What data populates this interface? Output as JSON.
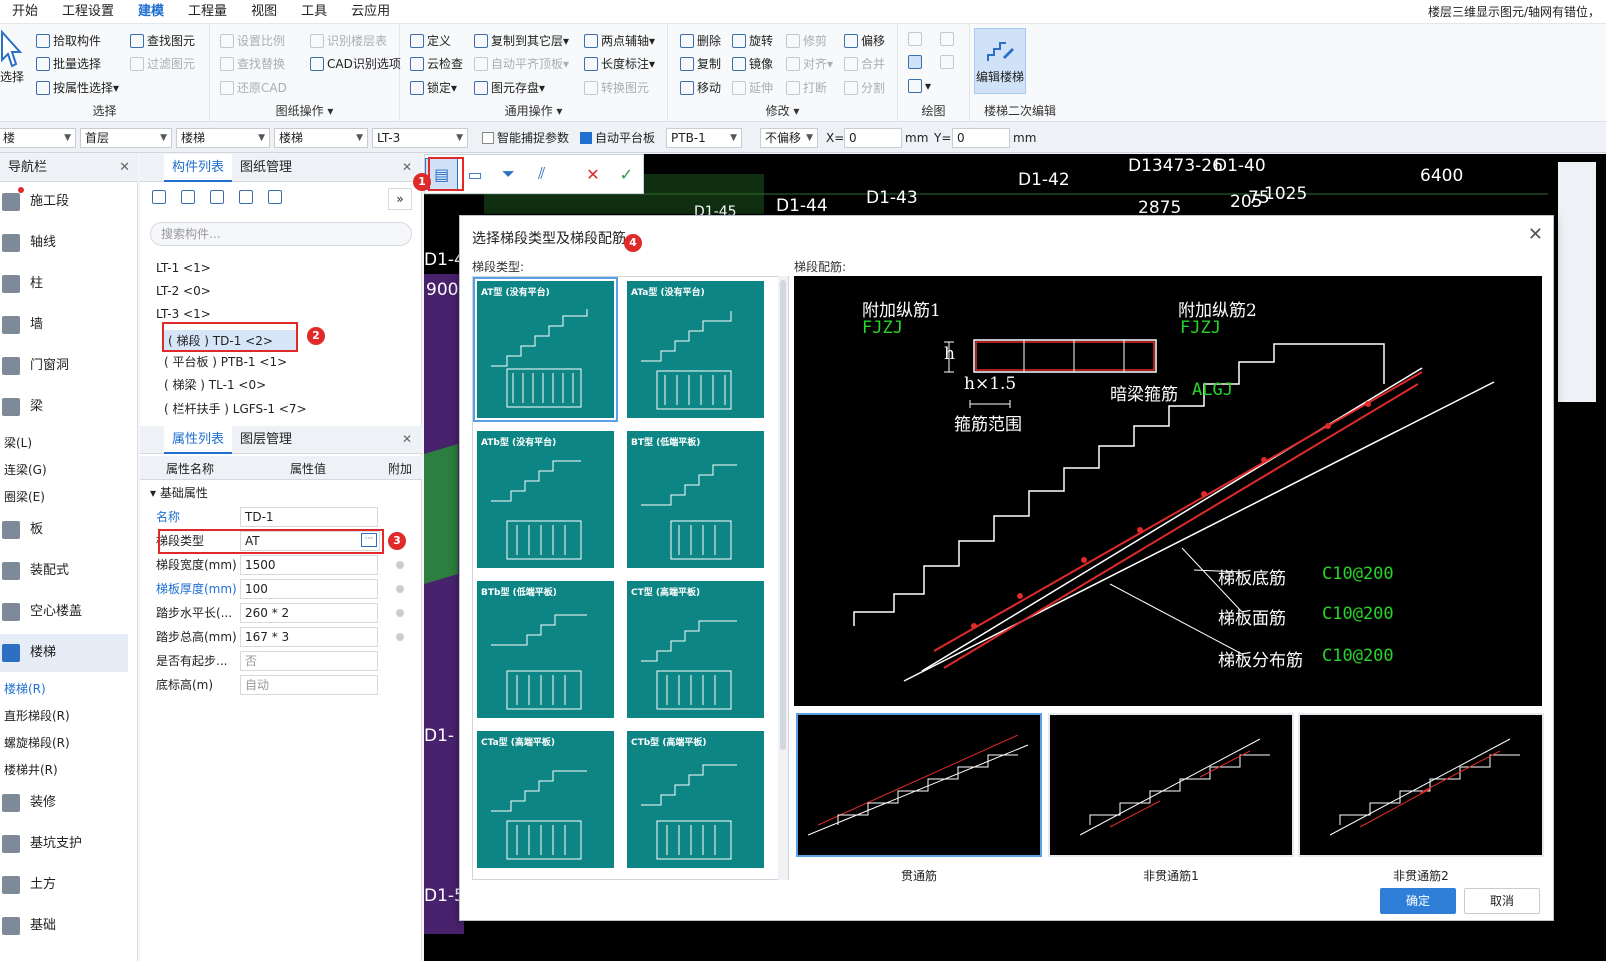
{
  "menubar": {
    "items": [
      "开始",
      "工程设置",
      "建模",
      "工程量",
      "视图",
      "工具",
      "云应用"
    ],
    "active": "建模",
    "status_right": "楼层三维显示图元/轴网有错位，"
  },
  "ribbon": {
    "select_group": {
      "title": "选择",
      "big": "选择",
      "items": [
        "拾取构件",
        "批量选择",
        "按属性选择"
      ]
    },
    "find_group": {
      "items": [
        "查找图元",
        "过滤图元"
      ]
    },
    "drawing_ops": {
      "title": "图纸操作",
      "items": [
        "设置比例",
        "识别楼层表",
        "查找替换",
        "CAD识别选项",
        "还原CAD"
      ]
    },
    "common_ops": {
      "title": "通用操作",
      "items": [
        "定义",
        "复制到其它层",
        "两点辅轴",
        "云检查",
        "自动平齐顶板",
        "长度标注",
        "锁定",
        "图元存盘",
        "转换图元"
      ]
    },
    "modify": {
      "title": "修改",
      "items": [
        "删除",
        "旋转",
        "修剪",
        "偏移",
        "复制",
        "镜像",
        "对齐",
        "合并",
        "移动",
        "延伸",
        "打断",
        "分割"
      ]
    },
    "draw": {
      "title": "绘图"
    },
    "stair_edit": {
      "title": "楼梯二次编辑",
      "button": "编辑楼梯"
    }
  },
  "toolbar": {
    "combo1": "楼",
    "combo2": "首层",
    "combo3": "楼梯",
    "combo4": "楼梯",
    "combo5": "LT-3",
    "smart_snap": "智能捕捉参数",
    "auto_platform": "自动平台板",
    "combo6": "PTB-1",
    "offset": "不偏移",
    "x_label": "X=",
    "x_value": "0",
    "y_label": "Y=",
    "y_value": "0",
    "unit": "mm"
  },
  "nav": {
    "title": "导航栏",
    "items": [
      "施工段",
      "轴线",
      "柱",
      "墙",
      "门窗洞",
      "梁",
      "板",
      "装配式",
      "空心楼盖",
      "楼梯",
      "装修",
      "基坑支护",
      "土方",
      "基础"
    ],
    "beam_sub": [
      "梁(L)",
      "连梁(G)",
      "圈梁(E)"
    ],
    "stair_sub": [
      "楼梯(R)",
      "直形梯段(R)",
      "螺旋梯段(R)",
      "楼梯井(R)"
    ]
  },
  "component_panel": {
    "tabs": [
      "构件列表",
      "图纸管理"
    ],
    "search_placeholder": "搜索构件...",
    "tree": [
      "LT-1 <1>",
      "LT-2 <0>",
      "LT-3 <1>",
      "( 梯段 ) TD-1 <2>",
      "( 平台板 ) PTB-1 <1>",
      "( 梯梁 ) TL-1 <0>",
      "( 栏杆扶手 ) LGFS-1 <7>"
    ]
  },
  "property_panel": {
    "tabs": [
      "属性列表",
      "图层管理"
    ],
    "headers": [
      "属性名称",
      "属性值",
      "附加"
    ],
    "section": "基础属性",
    "rows": [
      {
        "name": "名称",
        "value": "TD-1"
      },
      {
        "name": "梯段类型",
        "value": "AT"
      },
      {
        "name": "梯段宽度(mm)",
        "value": "1500"
      },
      {
        "name": "梯板厚度(mm)",
        "value": "100"
      },
      {
        "name": "踏步水平长(...",
        "value": "260 * 2"
      },
      {
        "name": "踏步总高(mm)",
        "value": "167 * 3"
      },
      {
        "name": "是否有起步...",
        "value": "否"
      },
      {
        "name": "底标高(m)",
        "value": "自动"
      }
    ]
  },
  "canvas": {
    "labels": [
      "D1-42",
      "D1-43",
      "D1-44",
      "D1-45",
      "D1-40",
      "6400",
      "2875",
      "205",
      "75",
      "1025",
      "900",
      "D13473-26",
      "D1-4",
      "D1-",
      "D1-5"
    ]
  },
  "badges": [
    "1",
    "2",
    "3",
    "4"
  ],
  "dialog": {
    "title": "选择梯段类型及梯段配筋",
    "type_label": "梯段类型:",
    "rebar_label": "梯段配筋:",
    "types": [
      "AT型 (没有平台)",
      "ATa型 (没有平台)",
      "ATb型 (没有平台)",
      "BT型 (低端平板)",
      "BTb型 (低端平板)",
      "CT型 (高端平板)",
      "CTa型 (高端平板)",
      "CTb型 (高端平板)"
    ],
    "preview": {
      "extra1": "附加纵筋1",
      "extra1_code": "FJZJ",
      "extra2": "附加纵筋2",
      "extra2_code": "FJZJ",
      "h": "h",
      "h15": "h×1.5",
      "stirrup_range": "箍筋范围",
      "hidden_beam": "暗梁箍筋",
      "hidden_beam_code": "ALGJ",
      "bottom": "梯板底筋",
      "bottom_val": "C10@200",
      "top": "梯板面筋",
      "top_val": "C10@200",
      "dist": "梯板分布筋",
      "dist_val": "C10@200"
    },
    "options": [
      "贯通筋",
      "非贯通筋1",
      "非贯通筋2"
    ],
    "ok": "确定",
    "cancel": "取消"
  },
  "colors": {
    "accent": "#1f6fd1",
    "teal": "#0e8585",
    "marker": "#e02a2a",
    "green_text": "#28d428"
  }
}
